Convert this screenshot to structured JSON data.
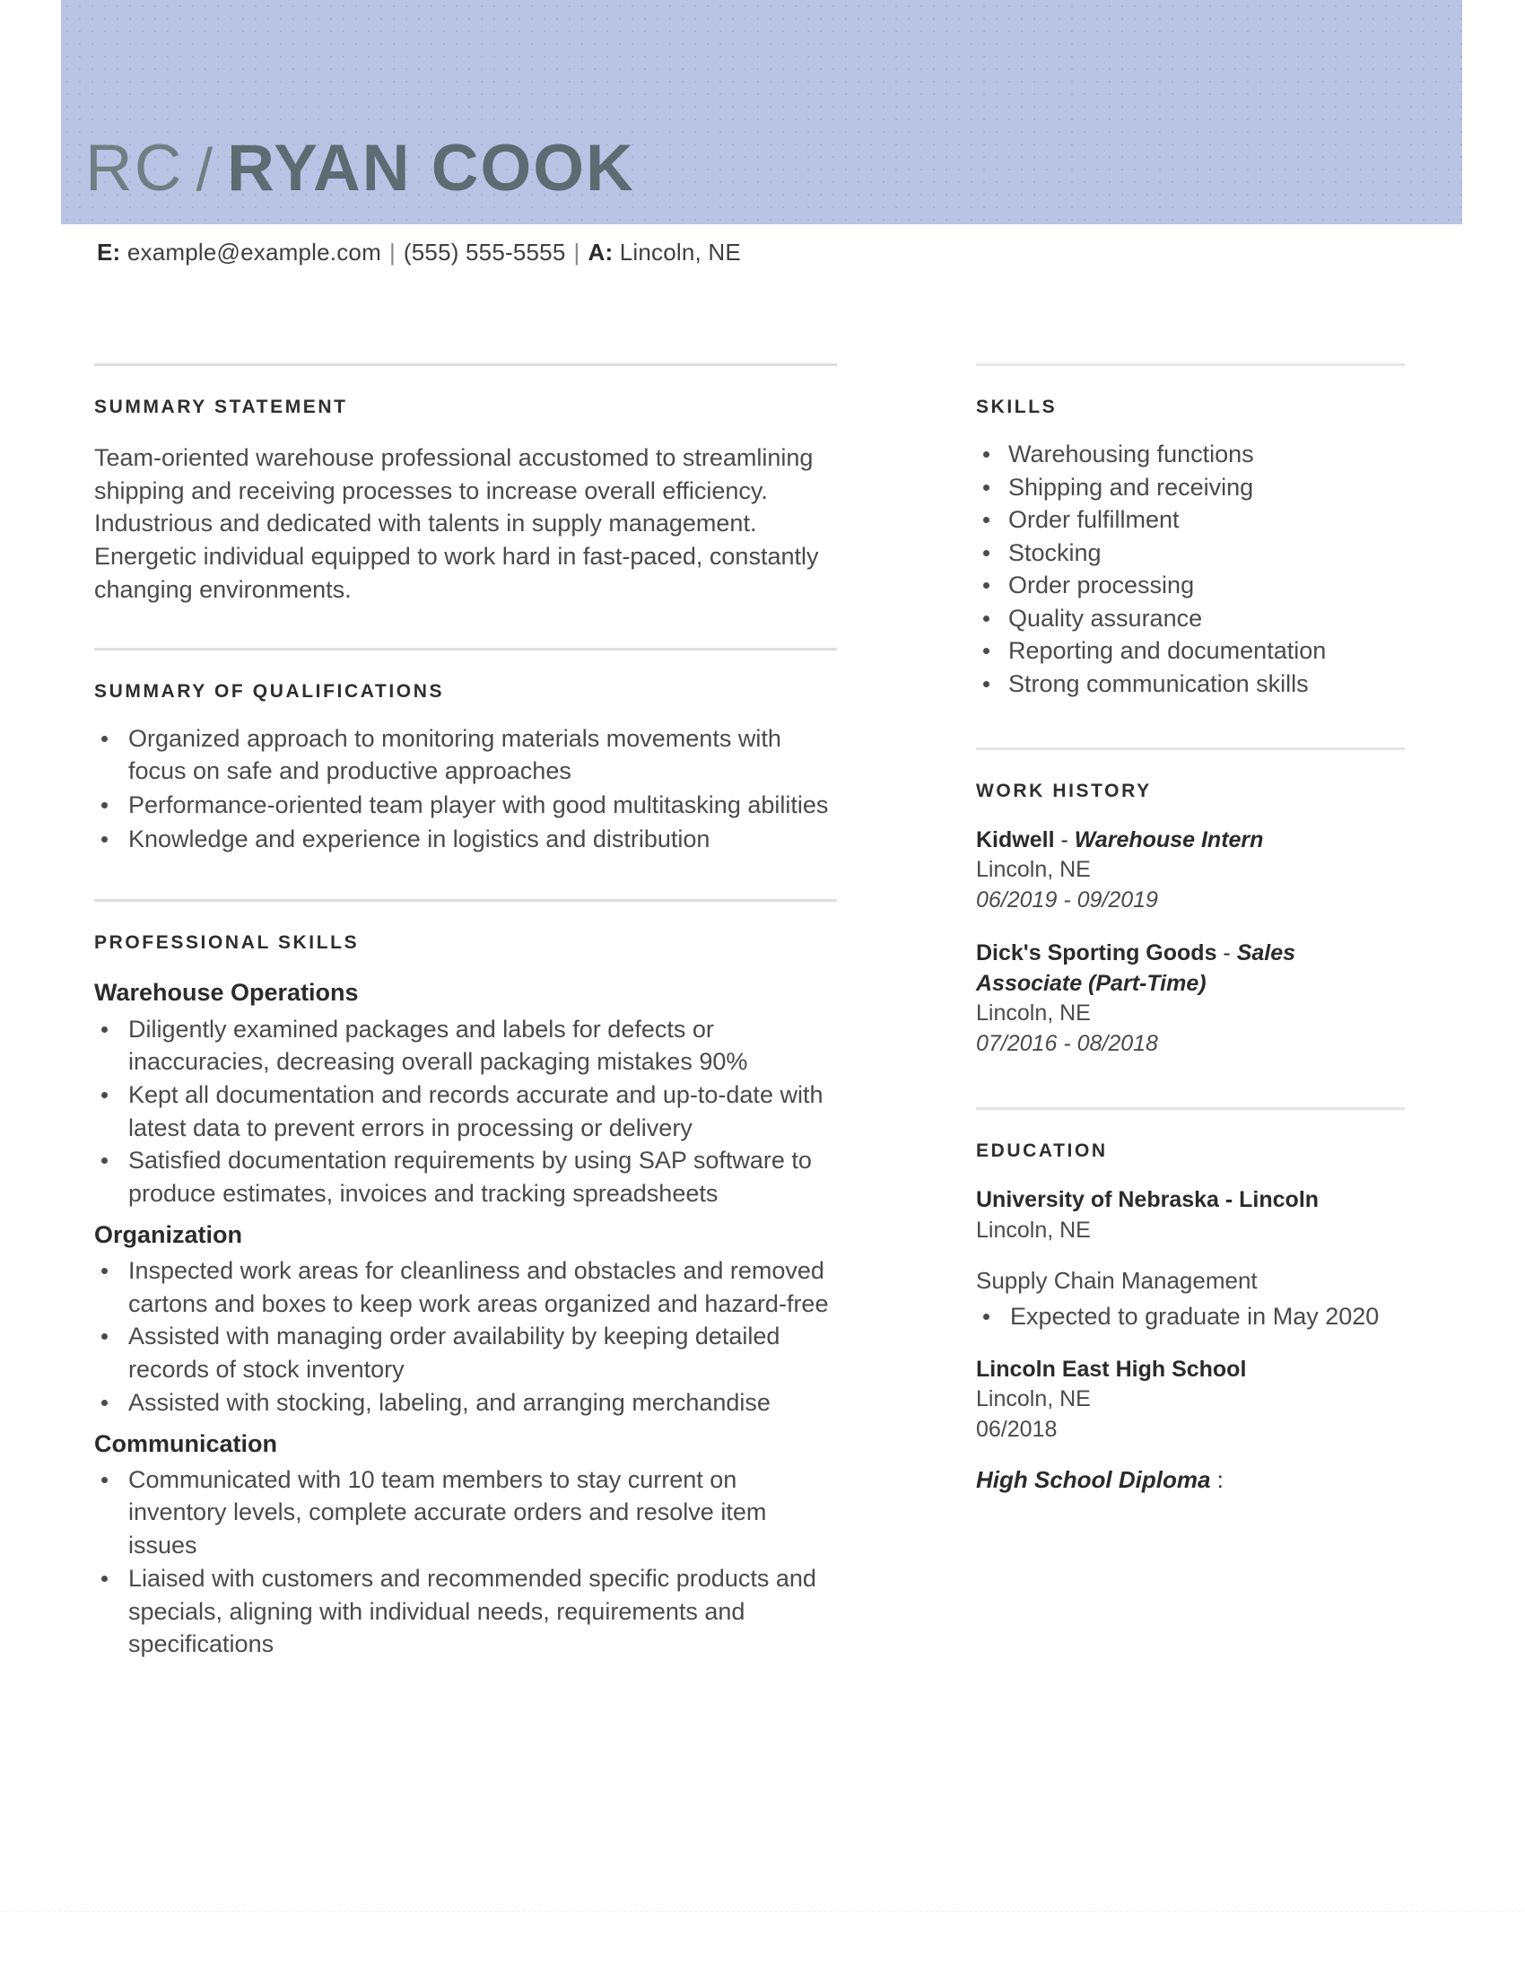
{
  "header": {
    "initials": "RC",
    "separator": "/",
    "full_name": "RYAN COOK",
    "band_color": "#b9c4e4",
    "name_color": "#5d6b72"
  },
  "contact": {
    "email_label": "E:",
    "email": "example@example.com",
    "divider": "|",
    "phone": "(555) 555-5555",
    "address_label": "A:",
    "address": "Lincoln, NE"
  },
  "left_column": {
    "summary_statement": {
      "title": "SUMMARY STATEMENT",
      "text": "Team-oriented warehouse professional accustomed to streamlining shipping and receiving processes to increase overall efficiency. Industrious and dedicated with talents in supply management. Energetic individual equipped to work hard in fast-paced, constantly changing environments."
    },
    "summary_of_qualifications": {
      "title": "SUMMARY OF QUALIFICATIONS",
      "items": [
        "Organized approach to monitoring materials movements with focus on safe and productive approaches",
        "Performance-oriented team player with good multitasking abilities",
        "Knowledge and experience in logistics and distribution"
      ]
    },
    "professional_skills": {
      "title": "PROFESSIONAL SKILLS",
      "groups": [
        {
          "heading": "Warehouse Operations",
          "items": [
            "Diligently examined packages and labels for defects or inaccuracies, decreasing overall packaging mistakes 90%",
            "Kept all documentation and records accurate and up-to-date with latest data to prevent errors in processing or delivery",
            "Satisfied documentation requirements by using SAP software to produce estimates, invoices and tracking spreadsheets"
          ]
        },
        {
          "heading": "Organization",
          "items": [
            "Inspected work areas for cleanliness and obstacles and removed cartons and boxes to keep work areas organized and hazard-free",
            "Assisted with managing order availability by keeping detailed records of stock inventory",
            "Assisted with stocking, labeling, and arranging merchandise"
          ]
        },
        {
          "heading": "Communication",
          "items": [
            "Communicated with 10 team members to stay current on inventory levels, complete accurate orders and resolve item issues",
            "Liaised with customers and recommended specific products and specials, aligning with individual needs, requirements and specifications"
          ]
        }
      ]
    }
  },
  "right_column": {
    "skills": {
      "title": "SKILLS",
      "items": [
        "Warehousing functions",
        "Shipping and receiving",
        "Order fulfillment",
        "Stocking",
        "Order processing",
        "Quality assurance",
        "Reporting and documentation",
        "Strong communication skills"
      ]
    },
    "work_history": {
      "title": "WORK HISTORY",
      "entries": [
        {
          "company": "Kidwell",
          "dash": " - ",
          "role": "Warehouse Intern",
          "location": "Lincoln, NE",
          "dates": "06/2019 - 09/2019"
        },
        {
          "company": "Dick's Sporting Goods",
          "dash": " - ",
          "role": "Sales Associate (Part-Time)",
          "location": "Lincoln, NE",
          "dates": "07/2016 - 08/2018"
        }
      ]
    },
    "education": {
      "title": "EDUCATION",
      "entries": [
        {
          "school": "University of Nebraska - Lincoln",
          "location": "Lincoln, NE",
          "program": "Supply Chain Management",
          "notes": [
            "Expected to graduate in May 2020"
          ]
        },
        {
          "school": "Lincoln East High School",
          "location": "Lincoln, NE",
          "dates": "06/2018"
        }
      ],
      "degree": "High School Diploma",
      "degree_colon": " :"
    }
  }
}
